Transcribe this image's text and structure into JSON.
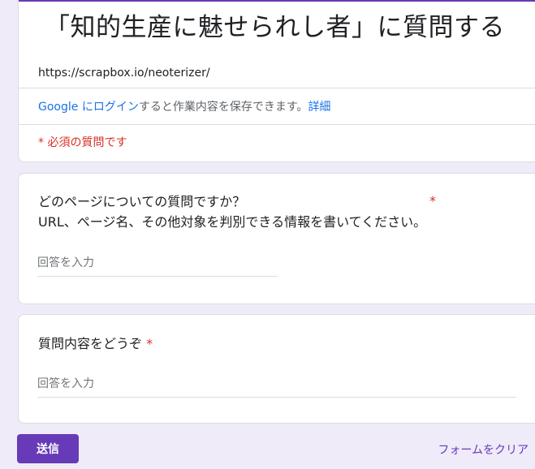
{
  "header": {
    "title": "「知的生産に魅せられし者」に質問する",
    "description": "https://scrapbox.io/neoterizer/",
    "login_link": "Google にログイン",
    "login_text": "すると作業内容を保存できます。",
    "details_link": "詳細",
    "required_note": "* 必須の質問です"
  },
  "questions": [
    {
      "title_line1": "どのページについての質問ですか？",
      "title_line2": "URL、ページ名、その他対象を判別できる情報を書いてください。",
      "required_mark": "*",
      "placeholder": "回答を入力"
    },
    {
      "title": "質問内容をどうぞ",
      "required_mark": "*",
      "placeholder": "回答を入力"
    }
  ],
  "footer": {
    "submit_label": "送信",
    "clear_label": "フォームをクリア"
  },
  "colors": {
    "accent": "#673ab7",
    "link": "#1a73e8",
    "required": "#d93025",
    "background": "#efebf8"
  }
}
